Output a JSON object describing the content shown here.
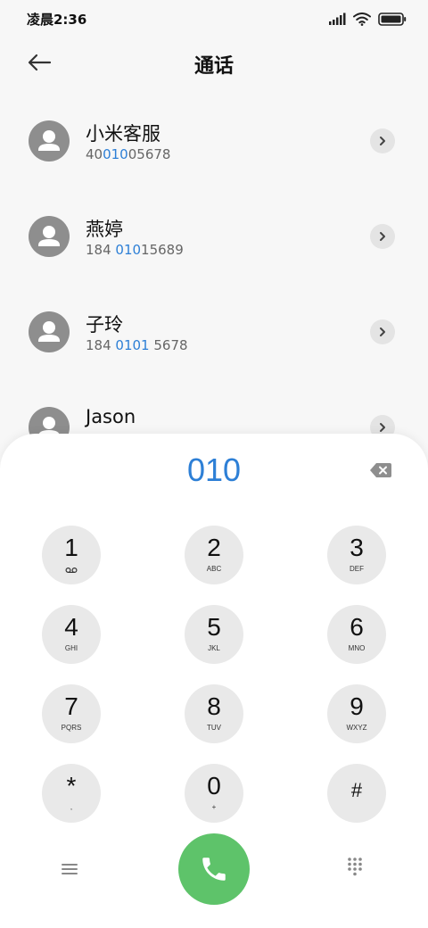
{
  "status_bar": {
    "time": "凌晨2:36"
  },
  "header": {
    "title": "通话"
  },
  "contacts": [
    {
      "name": "小米客服",
      "number_pre": "40",
      "number_match": "010",
      "number_post": "05678"
    },
    {
      "name": "燕婷",
      "number_pre": "184 ",
      "number_match": "010",
      "number_post": "15689"
    },
    {
      "name": "子玲",
      "number_pre": "184 ",
      "number_match": "0101",
      "number_post": " 5678"
    },
    {
      "name": "Jason",
      "number_pre": "",
      "number_match": "",
      "number_post": ""
    }
  ],
  "dialpad": {
    "input": "010",
    "keys": [
      {
        "digit": "1",
        "letters": ""
      },
      {
        "digit": "2",
        "letters": "ABC"
      },
      {
        "digit": "3",
        "letters": "DEF"
      },
      {
        "digit": "4",
        "letters": "GHI"
      },
      {
        "digit": "5",
        "letters": "JKL"
      },
      {
        "digit": "6",
        "letters": "MNO"
      },
      {
        "digit": "7",
        "letters": "PQRS"
      },
      {
        "digit": "8",
        "letters": "TUV"
      },
      {
        "digit": "9",
        "letters": "WXYZ"
      },
      {
        "digit": "*",
        "letters": ","
      },
      {
        "digit": "0",
        "letters": "+"
      },
      {
        "digit": "#",
        "letters": ""
      }
    ]
  },
  "icons": {
    "back": "arrow-left-icon",
    "voicemail": "voicemail-icon",
    "backspace": "backspace-icon",
    "menu": "menu-icon",
    "call": "phone-icon",
    "keypad": "keypad-icon"
  },
  "colors": {
    "accent": "#2d7fd6",
    "call_button": "#5ec36a",
    "key_background": "#e9e9e9",
    "avatar": "#8e8e8e"
  }
}
